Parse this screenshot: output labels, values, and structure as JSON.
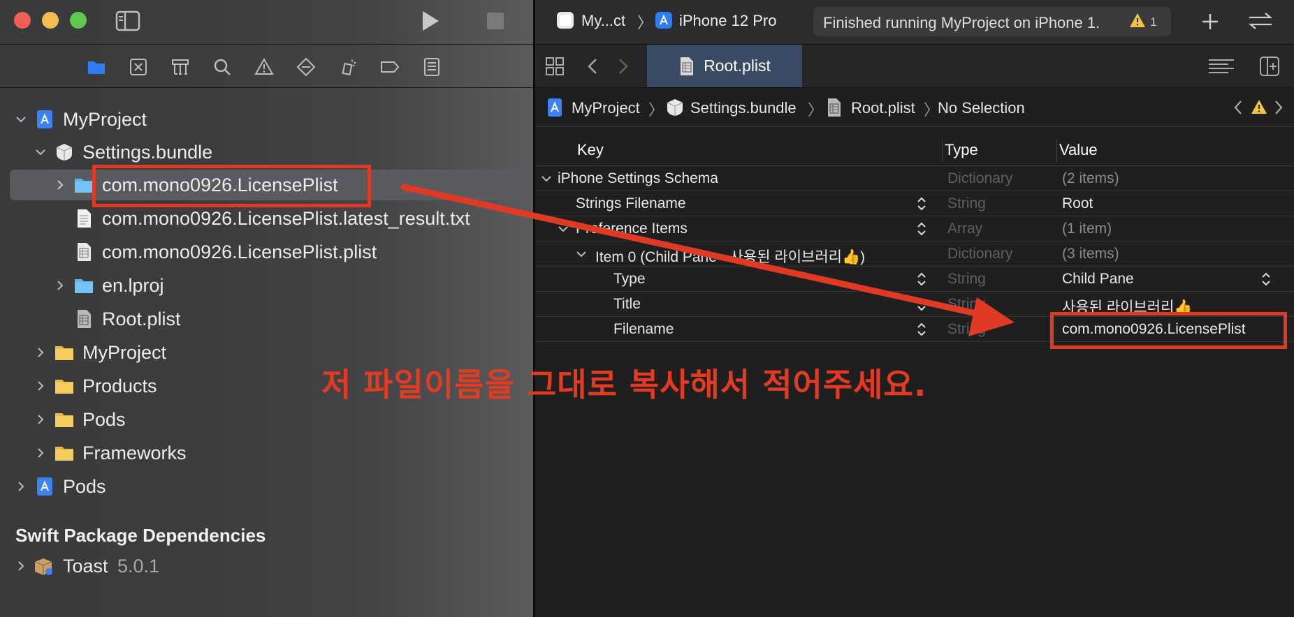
{
  "window": {
    "scheme_target": "My...ct",
    "device": "iPhone 12 Pro",
    "status": "Finished running MyProject on iPhone 1.",
    "warning_count": "1"
  },
  "navigator": {
    "tree": [
      {
        "label": "MyProject",
        "icon": "project-icon",
        "expanded": true
      },
      {
        "label": "Settings.bundle",
        "icon": "bundle-icon",
        "expanded": true
      },
      {
        "label": "com.mono0926.LicensePlist",
        "icon": "folder-icon",
        "expanded": false,
        "selected": true
      },
      {
        "label": "com.mono0926.LicensePlist.latest_result.txt",
        "icon": "text-file-icon"
      },
      {
        "label": "com.mono0926.LicensePlist.plist",
        "icon": "plist-file-icon"
      },
      {
        "label": "en.lproj",
        "icon": "folder-icon",
        "expanded": false
      },
      {
        "label": "Root.plist",
        "icon": "plist-file-icon"
      },
      {
        "label": "MyProject",
        "icon": "folder-icon",
        "expanded": false
      },
      {
        "label": "Products",
        "icon": "folder-icon",
        "expanded": false
      },
      {
        "label": "Pods",
        "icon": "folder-icon",
        "expanded": false
      },
      {
        "label": "Frameworks",
        "icon": "folder-icon",
        "expanded": false
      },
      {
        "label": "Pods",
        "icon": "project-icon",
        "expanded": false
      }
    ],
    "spm_header": "Swift Package Dependencies",
    "spm_package": {
      "name": "Toast",
      "version": "5.0.1"
    }
  },
  "editor": {
    "tab_label": "Root.plist",
    "breadcrumb": [
      "MyProject",
      "Settings.bundle",
      "Root.plist",
      "No Selection"
    ],
    "columns": {
      "key": "Key",
      "type": "Type",
      "value": "Value"
    },
    "rows": [
      {
        "key": "iPhone Settings Schema",
        "type": "Dictionary",
        "value": "(2 items)"
      },
      {
        "key": "Strings Filename",
        "type": "String",
        "value": "Root"
      },
      {
        "key": "Preference Items",
        "type": "Array",
        "value": "(1 item)"
      },
      {
        "key": "Item 0 (Child Pane - 사용된 라이브러리👍)",
        "type": "Dictionary",
        "value": "(3 items)"
      },
      {
        "key": "Type",
        "type": "String",
        "value": "Child Pane"
      },
      {
        "key": "Title",
        "type": "String",
        "value": "사용된 라이브러리👍"
      },
      {
        "key": "Filename",
        "type": "String",
        "value": "com.mono0926.LicensePlist"
      }
    ]
  },
  "annotation": {
    "text": "저 파일이름을 그대로 복사해서 적어주세요.",
    "color": "#e03a24"
  }
}
